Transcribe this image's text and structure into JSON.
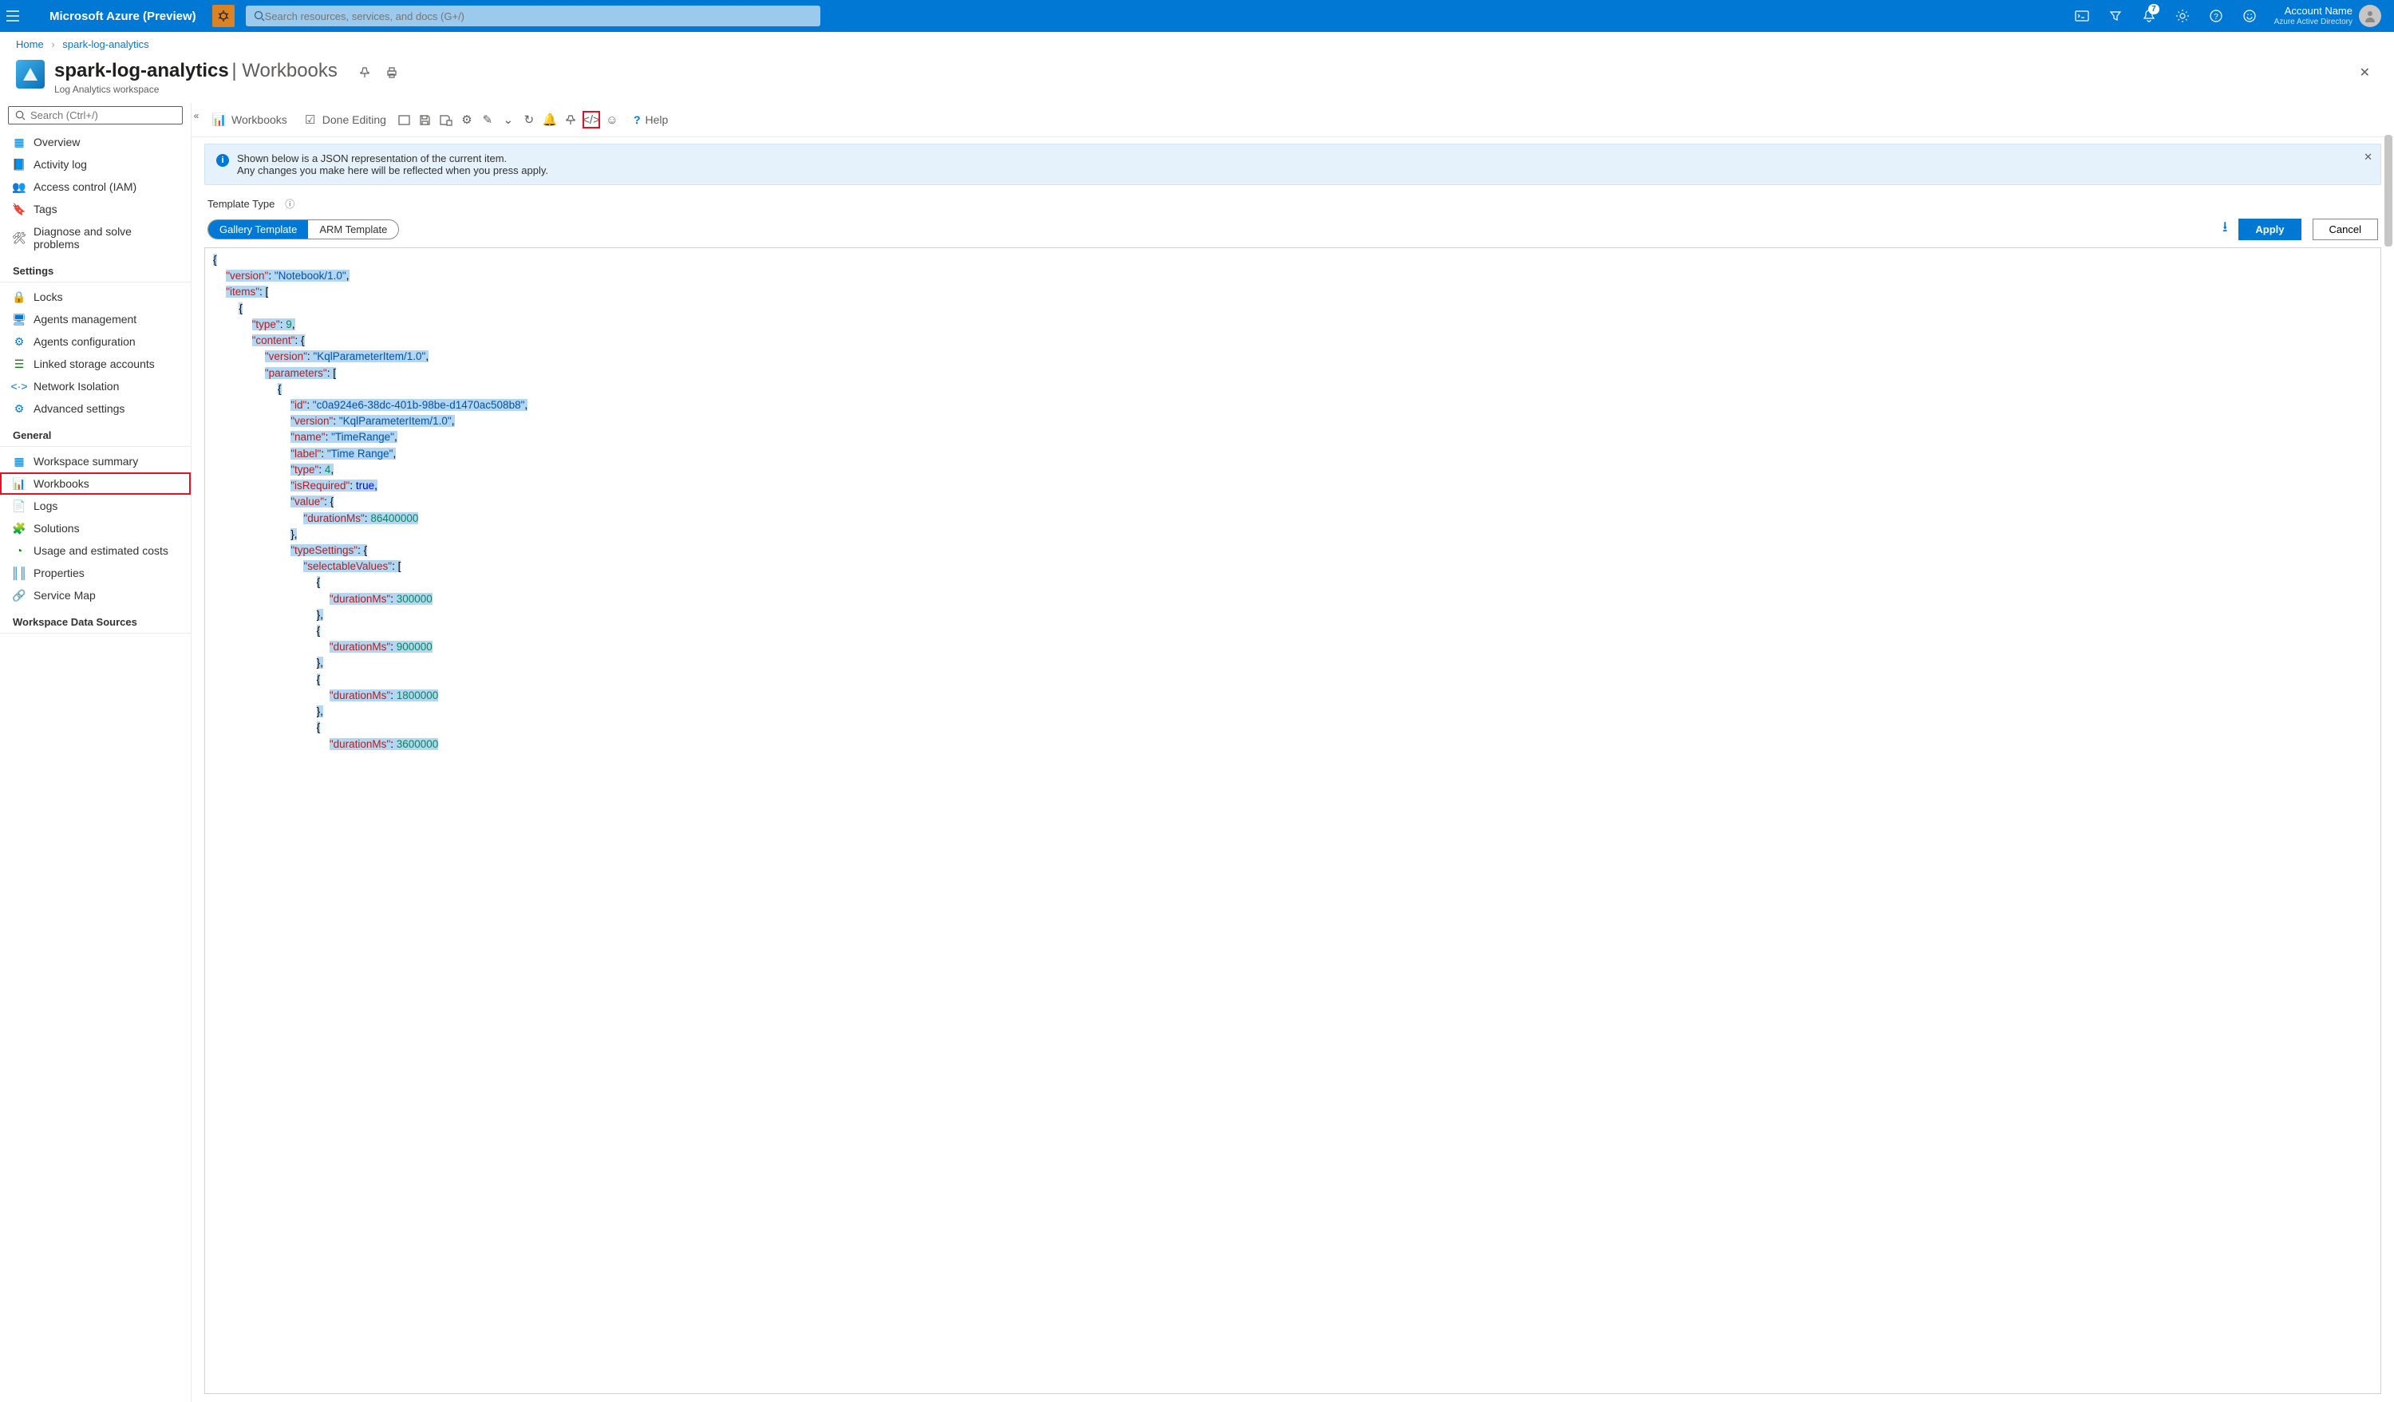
{
  "topbar": {
    "brand": "Microsoft Azure (Preview)",
    "search_placeholder": "Search resources, services, and docs (G+/)",
    "notifications_count": "7",
    "account_name": "Account Name",
    "directory": "Azure Active Directory"
  },
  "breadcrumb": {
    "home": "Home",
    "resource": "spark-log-analytics"
  },
  "header": {
    "title": "spark-log-analytics",
    "subtitle": "Workbooks",
    "kind": "Log Analytics workspace"
  },
  "sidebar": {
    "search_placeholder": "Search (Ctrl+/)",
    "items_top": [
      {
        "label": "Overview",
        "icon": "overview"
      },
      {
        "label": "Activity log",
        "icon": "activity"
      },
      {
        "label": "Access control (IAM)",
        "icon": "iam"
      },
      {
        "label": "Tags",
        "icon": "tags"
      },
      {
        "label": "Diagnose and solve problems",
        "icon": "diagnose"
      }
    ],
    "group_settings": "Settings",
    "items_settings": [
      {
        "label": "Locks",
        "icon": "lock"
      },
      {
        "label": "Agents management",
        "icon": "agents-mgmt"
      },
      {
        "label": "Agents configuration",
        "icon": "agents-cfg"
      },
      {
        "label": "Linked storage accounts",
        "icon": "storage"
      },
      {
        "label": "Network Isolation",
        "icon": "network"
      },
      {
        "label": "Advanced settings",
        "icon": "gear"
      }
    ],
    "group_general": "General",
    "items_general": [
      {
        "label": "Workspace summary",
        "icon": "summary"
      },
      {
        "label": "Workbooks",
        "icon": "workbook",
        "selected": true
      },
      {
        "label": "Logs",
        "icon": "logs"
      },
      {
        "label": "Solutions",
        "icon": "solutions"
      },
      {
        "label": "Usage and estimated costs",
        "icon": "usage"
      },
      {
        "label": "Properties",
        "icon": "props"
      },
      {
        "label": "Service Map",
        "icon": "svcmap"
      }
    ],
    "group_ds": "Workspace Data Sources"
  },
  "toolbar": {
    "workbooks": "Workbooks",
    "done_editing": "Done Editing",
    "help": "Help"
  },
  "banner": {
    "l1": "Shown below is a JSON representation of the current item.",
    "l2": "Any changes you make here will be reflected when you press apply."
  },
  "template": {
    "label": "Template Type",
    "gallery": "Gallery Template",
    "arm": "ARM Template",
    "apply": "Apply",
    "cancel": "Cancel"
  },
  "code": {
    "version_k": "\"version\"",
    "version_v": "\"Notebook/1.0\"",
    "items_k": "\"items\"",
    "type_k": "\"type\"",
    "type_v": "9",
    "content_k": "\"content\"",
    "iversion_v": "\"KqlParameterItem/1.0\"",
    "parameters_k": "\"parameters\"",
    "id_k": "\"id\"",
    "id_v": "\"c0a924e6-38dc-401b-98be-d1470ac508b8\"",
    "name_k": "\"name\"",
    "name_v": "\"TimeRange\"",
    "label_k": "\"label\"",
    "label_v": "\"Time Range\"",
    "ptype_v": "4",
    "isreq_k": "\"isRequired\"",
    "isreq_v": "true",
    "value_k": "\"value\"",
    "dur_k": "\"durationMs\"",
    "dur_v0": "86400000",
    "ts_k": "\"typeSettings\"",
    "sv_k": "\"selectableValues\"",
    "dur_v1": "300000",
    "dur_v2": "900000",
    "dur_v3": "1800000",
    "dur_v4": "3600000"
  }
}
